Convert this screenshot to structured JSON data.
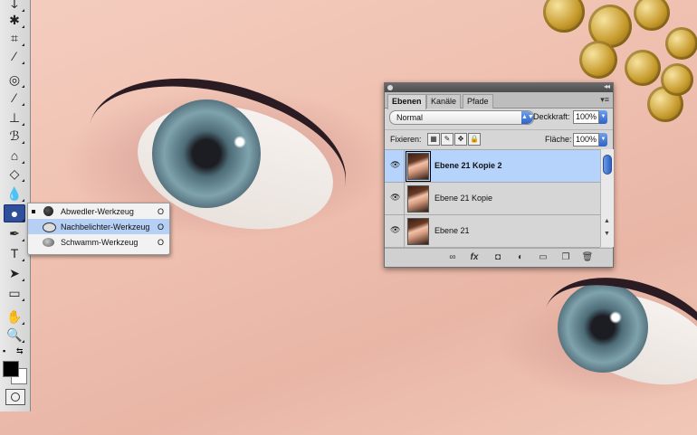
{
  "toolbar": {
    "tools": [
      {
        "name": "lasso-tool",
        "glyph": "ↆ"
      },
      {
        "name": "magic-wand-tool",
        "glyph": "✱"
      },
      {
        "name": "crop-tool",
        "glyph": "⌗"
      },
      {
        "name": "eyedropper-tool",
        "glyph": "⁄"
      },
      {
        "name": "spot-healing-tool",
        "glyph": "◎"
      },
      {
        "name": "brush-tool",
        "glyph": "⁄"
      },
      {
        "name": "clone-stamp-tool",
        "glyph": "⊥"
      },
      {
        "name": "history-brush-tool",
        "glyph": "ℬ"
      },
      {
        "name": "eraser-tool",
        "glyph": "⌂"
      },
      {
        "name": "paint-bucket-tool",
        "glyph": "◇"
      },
      {
        "name": "blur-tool",
        "glyph": "💧"
      },
      {
        "name": "dodge-tool",
        "glyph": "●"
      },
      {
        "name": "pen-tool",
        "glyph": "✒"
      },
      {
        "name": "type-tool",
        "glyph": "T"
      },
      {
        "name": "path-selection-tool",
        "glyph": "➤"
      },
      {
        "name": "rectangle-tool",
        "glyph": "▭"
      },
      {
        "name": "hand-tool",
        "glyph": "✋"
      },
      {
        "name": "zoom-tool",
        "glyph": "🔍"
      }
    ]
  },
  "flyout": {
    "items": [
      {
        "label": "Abwedler-Werkzeug",
        "shortcut": "O",
        "current": true,
        "selected": false
      },
      {
        "label": "Nachbelichter-Werkzeug",
        "shortcut": "O",
        "current": false,
        "selected": true
      },
      {
        "label": "Schwamm-Werkzeug",
        "shortcut": "O",
        "current": false,
        "selected": false
      }
    ]
  },
  "panel": {
    "tabs": [
      "Ebenen",
      "Kanäle",
      "Pfade"
    ],
    "blend_mode": "Normal",
    "opacity_label": "Deckkraft:",
    "opacity_value": "100%",
    "lock_label": "Fixieren:",
    "fill_label": "Fläche:",
    "fill_value": "100%",
    "layers": [
      {
        "name": "Ebene 21 Kopie 2",
        "selected": true
      },
      {
        "name": "Ebene 21 Kopie",
        "selected": false
      },
      {
        "name": "Ebene 21",
        "selected": false
      }
    ],
    "footer_buttons": [
      "link-icon",
      "fx-icon",
      "mask-icon",
      "adjustment-icon",
      "group-folder-icon",
      "new-layer-icon",
      "trash-icon"
    ]
  }
}
